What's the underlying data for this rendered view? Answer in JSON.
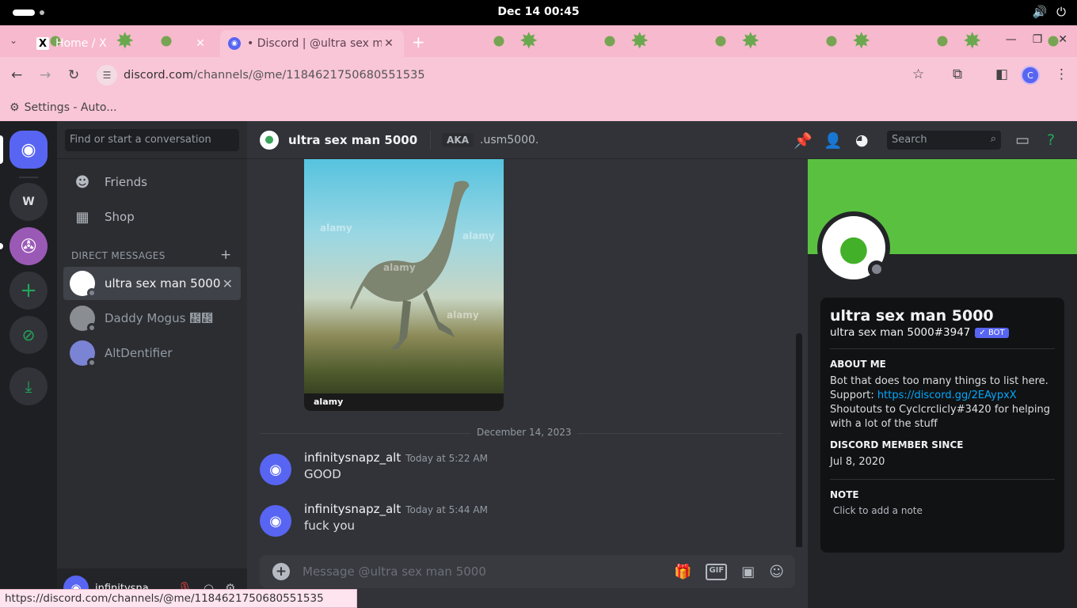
{
  "os": {
    "clock": "Dec 14  00:45"
  },
  "browser": {
    "tabs": [
      {
        "title": "Home / X",
        "favicon": "x-logo-icon",
        "active": false
      },
      {
        "title": "• Discord | @ultra sex ma",
        "favicon": "discord-icon",
        "active": true
      }
    ],
    "url_domain": "discord.com",
    "url_path": "/channels/@me/1184621750680551535",
    "bookmark_label": "Settings - Auto...",
    "profile_initial": "C",
    "status_bar_url": "https://discord.com/channels/@me/1184621750680551535"
  },
  "rail": {
    "w_label": "W"
  },
  "sidebar": {
    "search_placeholder": "Find or start a conversation",
    "friends_label": "Friends",
    "shop_label": "Shop",
    "dm_header": "DIRECT MESSAGES",
    "dms": [
      {
        "name": "ultra sex man 5000",
        "selected": true
      },
      {
        "name": "Daddy Mogus ᲼᲼",
        "selected": false
      },
      {
        "name": "AltDentifier",
        "selected": false
      }
    ],
    "user_name": "infinitysna..."
  },
  "chat": {
    "header_name": "ultra sex man 5000",
    "aka_label": "AKA",
    "alias": ".usm5000.",
    "search_placeholder": "Search",
    "image_brand": "alamy",
    "date_divider": "December 14, 2023",
    "messages": [
      {
        "author": "infinitysnapz_alt",
        "time": "Today at 5:22 AM",
        "text": "GOOD"
      },
      {
        "author": "infinitysnapz_alt",
        "time": "Today at 5:44 AM",
        "text": "fuck you"
      }
    ],
    "composer_placeholder": "Message @ultra sex man 5000",
    "gif_label": "GIF"
  },
  "profile": {
    "display_name": "ultra sex man 5000",
    "tag": "ultra sex man 5000#3947",
    "bot_badge": "✓ BOT",
    "about_heading": "ABOUT ME",
    "about_line1": "Bot that does too many things to list here.",
    "support_label": "Support: ",
    "support_link": "https://discord.gg/2EAypxX",
    "about_line2": "Shoutouts to Cyclcrclicly#3420 for helping with a lot of the stuff",
    "member_since_heading": "DISCORD MEMBER SINCE",
    "member_since": "Jul 8, 2020",
    "note_heading": "NOTE",
    "note_placeholder": "Click to add a note"
  },
  "colors": {
    "blurple": "#5865f2",
    "green": "#23a55a",
    "banner": "#5ac140",
    "tab_pink": "#f9c6d7"
  }
}
